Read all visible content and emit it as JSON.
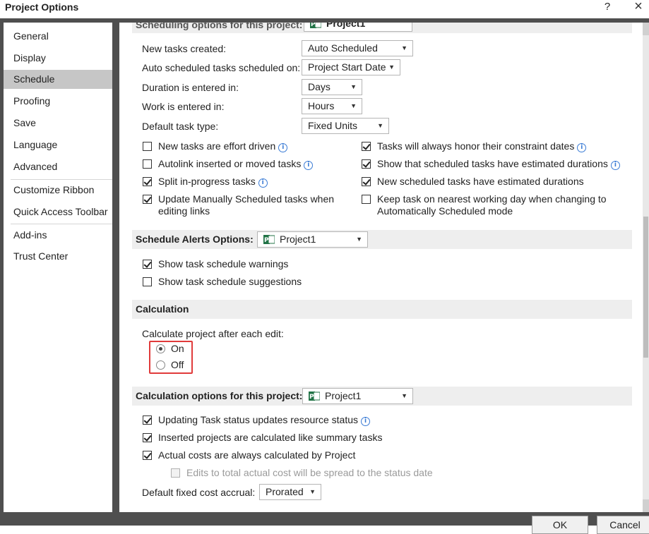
{
  "window": {
    "title": "Project Options",
    "help_label": "?",
    "close_label": "×"
  },
  "sidebar": {
    "items": [
      {
        "label": "General"
      },
      {
        "label": "Display"
      },
      {
        "label": "Schedule"
      },
      {
        "label": "Proofing"
      },
      {
        "label": "Save"
      },
      {
        "label": "Language"
      },
      {
        "label": "Advanced"
      },
      {
        "label": "Customize Ribbon"
      },
      {
        "label": "Quick Access Toolbar"
      },
      {
        "label": "Add-ins"
      },
      {
        "label": "Trust Center"
      }
    ],
    "selected": "Schedule"
  },
  "scheduling": {
    "header_label": "Scheduling options for this project:",
    "project_value": "Project1",
    "fields": [
      {
        "label": "New tasks created:",
        "value": "Auto Scheduled"
      },
      {
        "label": "Auto scheduled tasks scheduled on:",
        "value": "Project Start Date"
      },
      {
        "label": "Duration is entered in:",
        "value": "Days"
      },
      {
        "label": "Work is entered in:",
        "value": "Hours"
      },
      {
        "label": "Default task type:",
        "value": "Fixed Units"
      }
    ],
    "left_checks": [
      {
        "label": "New tasks are effort driven",
        "checked": false
      },
      {
        "label": "Autolink inserted or moved tasks",
        "checked": false
      },
      {
        "label": "Split in-progress tasks",
        "checked": true
      },
      {
        "label_line1": "Update Manually Scheduled tasks when",
        "label_line2": "editing links",
        "checked": true
      }
    ],
    "right_checks": [
      {
        "label": "Tasks will always honor their constraint dates",
        "checked": true
      },
      {
        "label": "Show that scheduled tasks have estimated durations",
        "checked": true
      },
      {
        "label": "New scheduled tasks have estimated durations",
        "checked": true
      },
      {
        "label_line1": "Keep task on nearest working day when changing to",
        "label_line2": "Automatically Scheduled mode",
        "checked": false
      }
    ]
  },
  "alerts": {
    "header_label": "Schedule Alerts Options:",
    "project_value": "Project1",
    "checks": [
      {
        "label": "Show task schedule warnings",
        "checked": true
      },
      {
        "label": "Show task schedule suggestions",
        "checked": false
      }
    ]
  },
  "calculation": {
    "header_label": "Calculation",
    "prompt": "Calculate project after each edit:",
    "options": [
      {
        "label": "On",
        "selected": true
      },
      {
        "label": "Off",
        "selected": false
      }
    ]
  },
  "calc_options": {
    "header_label": "Calculation options for this project:",
    "project_value": "Project1",
    "checks": [
      {
        "label": "Updating Task status updates resource status",
        "checked": true
      },
      {
        "label": "Inserted projects are calculated like summary tasks",
        "checked": true
      },
      {
        "label": "Actual costs are always calculated by Project",
        "checked": true
      },
      {
        "label": "Edits to total actual cost will be spread to the status date",
        "checked": false,
        "disabled": true
      }
    ],
    "fixed_cost_label": "Default fixed cost accrual:",
    "fixed_cost_value": "Prorated"
  },
  "footer": {
    "ok_label": "OK",
    "cancel_label": "Cancel"
  },
  "colors": {
    "frame": "#4f4f4f",
    "selected_nav": "#c6c6c6",
    "section_header": "#eeeeee",
    "highlight_box": "#e03b3b",
    "info_icon": "#3a7bd5"
  }
}
